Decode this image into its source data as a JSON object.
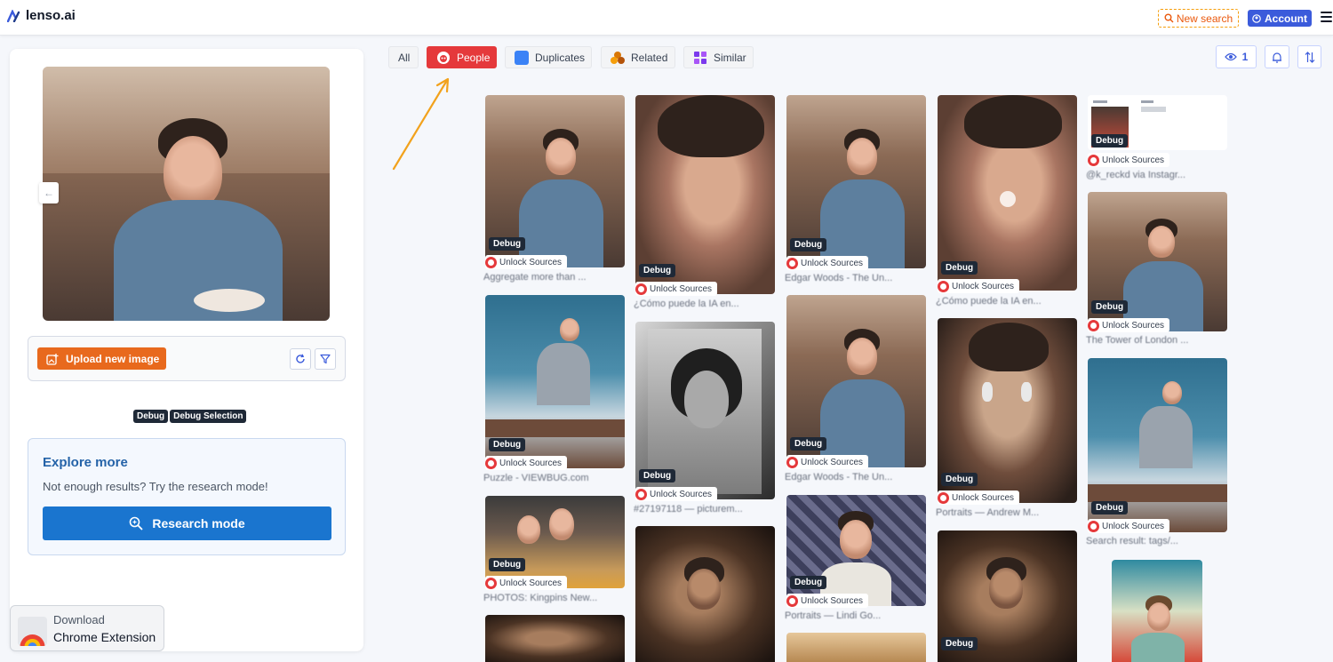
{
  "header": {
    "brand": "lenso.ai",
    "new_search": "New search",
    "account": "Account"
  },
  "left": {
    "upload_label": "Upload new image",
    "debug": "Debug",
    "debug_selection": "Debug Selection",
    "explore_title": "Explore more",
    "explore_text": "Not enough results? Try the research mode!",
    "research_label": "Research mode",
    "ext_line1": "Download",
    "ext_line2": "Chrome Extension"
  },
  "filters": {
    "all": "All",
    "people": "People",
    "duplicates": "Duplicates",
    "related": "Related",
    "similar": "Similar",
    "views": "1"
  },
  "colors": {
    "accent_red": "#e5393b",
    "brand_blue": "#3b5bdb",
    "upload_orange": "#e8691d",
    "research_blue": "#1a75cf"
  },
  "results": {
    "debug": "Debug",
    "unlock": "Unlock Sources",
    "items": [
      {
        "caption": "Aggregate more than ..."
      },
      {
        "caption": "Puzzle - VIEWBUG.com"
      },
      {
        "caption": "PHOTOS: Kingpins New..."
      },
      {
        "caption": "¿Cómo puede la IA en..."
      },
      {
        "caption": "#27197118 — picturem..."
      },
      {
        "caption": "Edgar Woods - The Un..."
      },
      {
        "caption": "Edgar Woods - The Un..."
      },
      {
        "caption": "Portraits — Lindi Go..."
      },
      {
        "caption": "¿Cómo puede la IA en..."
      },
      {
        "caption": "Portraits — Andrew M..."
      },
      {
        "caption": "@k_reckd via Instagr..."
      },
      {
        "caption": "The Tower of London ..."
      },
      {
        "caption": "Search result: tags/..."
      }
    ]
  }
}
